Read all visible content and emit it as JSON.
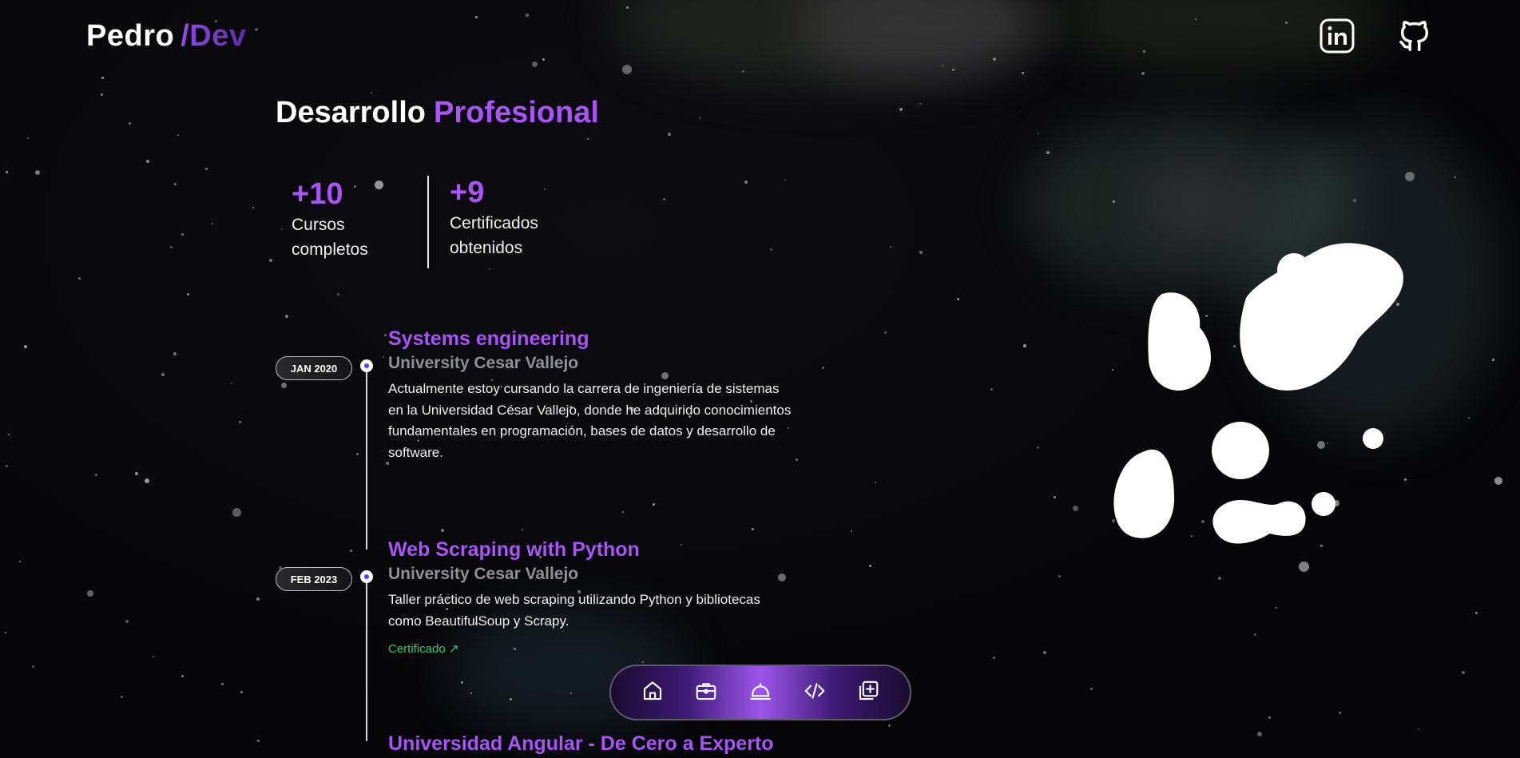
{
  "header": {
    "logo_name": "Pedro",
    "logo_accent": "/Dev",
    "social": [
      {
        "icon": "linkedin-icon",
        "label": "LinkedIn"
      },
      {
        "icon": "github-icon",
        "label": "GitHub"
      }
    ]
  },
  "section": {
    "title_main": "Desarrollo",
    "title_accent": "Profesional"
  },
  "stats": [
    {
      "value": "+10",
      "label": "Cursos completos"
    },
    {
      "value": "+9",
      "label": "Certificados obtenidos"
    }
  ],
  "timeline": [
    {
      "date": "JAN 2020",
      "title": "Systems engineering",
      "org": "University Cesar Vallejo",
      "description": "Actualmente estoy cursando la carrera de ingeniería de sistemas en la Universidad César Vallejo, donde he adquirido conocimientos fundamentales en programación, bases de datos y desarrollo de software."
    },
    {
      "date": "FEB 2023",
      "title": "Web Scraping with Python",
      "org": "University Cesar Vallejo",
      "description": "Taller práctico de web scraping utilizando Python y bibliotecas como BeautifulSoup y Scrapy.",
      "link_label": "Certificado ↗"
    },
    {
      "title": "Universidad Angular - De Cero a Experto"
    }
  ],
  "dock": {
    "items": [
      {
        "icon": "home-icon"
      },
      {
        "icon": "briefcase-icon"
      },
      {
        "icon": "bell-icon",
        "active": true
      },
      {
        "icon": "code-icon"
      },
      {
        "icon": "add-square-icon"
      }
    ]
  },
  "colors": {
    "accent": "#a855f7",
    "background": "#08080a",
    "org_gray": "#8d8f99",
    "link_green": "#2ecc71",
    "timeline_dot": "#4c46e6"
  }
}
